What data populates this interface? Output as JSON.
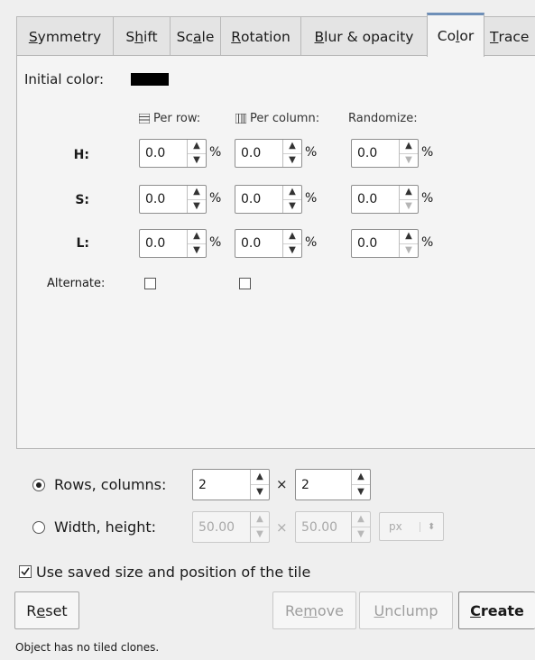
{
  "tabs": [
    {
      "pre": "",
      "u": "S",
      "post": "ymmetry"
    },
    {
      "pre": "S",
      "u": "h",
      "post": "ift"
    },
    {
      "pre": "Sc",
      "u": "a",
      "post": "le"
    },
    {
      "pre": "",
      "u": "R",
      "post": "otation"
    },
    {
      "pre": "",
      "u": "B",
      "post": "lur & opacity"
    },
    {
      "pre": "Co",
      "u": "l",
      "post": "or"
    },
    {
      "pre": "",
      "u": "T",
      "post": "race"
    }
  ],
  "color": {
    "initial_label": "Initial color:",
    "initial_swatch": "#000000",
    "headers": {
      "per_row": "Per row:",
      "per_column": "Per column:",
      "randomize": "Randomize:"
    },
    "rows": [
      {
        "label": "H:",
        "per_row": "0.0",
        "per_column": "0.0",
        "randomize": "0.0"
      },
      {
        "label": "S:",
        "per_row": "0.0",
        "per_column": "0.0",
        "randomize": "0.0"
      },
      {
        "label": "L:",
        "per_row": "0.0",
        "per_column": "0.0",
        "randomize": "0.0"
      }
    ],
    "unit": "%",
    "alternate_label": "Alternate:"
  },
  "grid": {
    "rows_columns_label": "Rows, columns:",
    "rows": "2",
    "columns": "2",
    "times": "×",
    "width_height_label": "Width, height:",
    "width": "50.00",
    "height": "50.00",
    "unit": "px"
  },
  "use_saved_label": "Use saved size and position of the tile",
  "buttons": {
    "reset": {
      "pre": "R",
      "u": "e",
      "post": "set"
    },
    "remove": {
      "pre": "Re",
      "u": "m",
      "post": "ove"
    },
    "unclump": {
      "pre": "",
      "u": "U",
      "post": "nclump"
    },
    "create": {
      "pre": "",
      "u": "C",
      "post": "reate"
    }
  },
  "status": "Object has no tiled clones."
}
